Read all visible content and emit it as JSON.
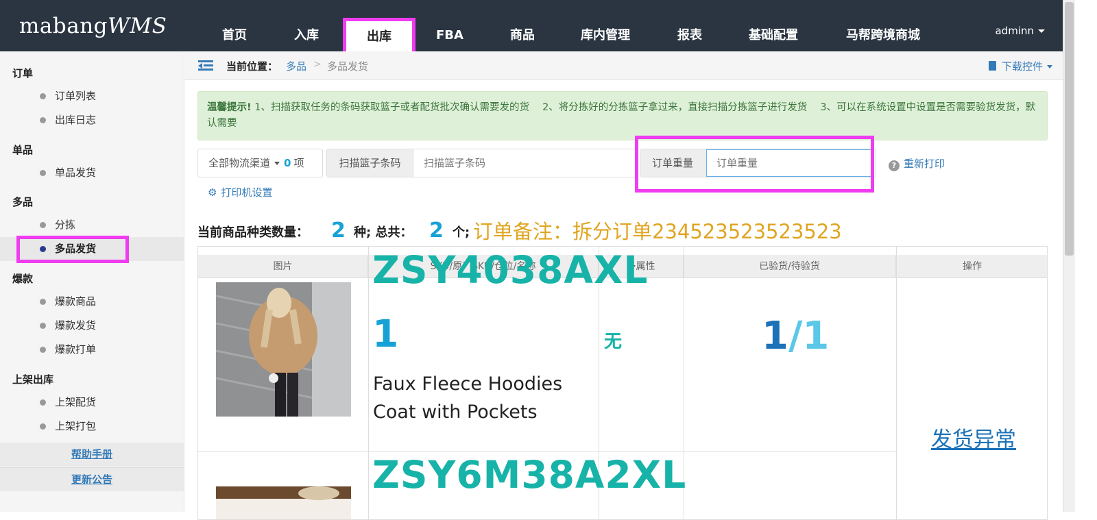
{
  "app": {
    "logo_main": "mabang",
    "logo_italic": "WMS",
    "user": "adminn"
  },
  "nav": [
    "首页",
    "入库",
    "出库",
    "FBA",
    "商品",
    "库内管理",
    "报表",
    "基础配置",
    "马帮跨境商城"
  ],
  "nav_active": "出库",
  "sidebar": {
    "groups": [
      {
        "title": "订单",
        "items": [
          "订单列表",
          "出库日志"
        ]
      },
      {
        "title": "单品",
        "items": [
          "单品发货"
        ]
      },
      {
        "title": "多品",
        "items": [
          "分拣",
          "多品发货"
        ]
      },
      {
        "title": "爆款",
        "items": [
          "爆款商品",
          "爆款发货",
          "爆款打单"
        ]
      },
      {
        "title": "上架出库",
        "items": [
          "上架配货",
          "上架打包"
        ]
      }
    ],
    "active_item": "多品发货",
    "links": [
      "帮助手册",
      "更新公告"
    ]
  },
  "breadcrumb": {
    "label": "当前位置：",
    "level1": "多品",
    "sep": ">",
    "level2": "多品发货"
  },
  "download_control": "下载控件",
  "alert": {
    "strong": "温馨提示!",
    "text": " 1、扫描获取任务的条码获取篮子或者配货批次确认需要发的货　 2、将分拣好的分拣篮子拿过来，直接扫描分拣篮子进行发货　 3、可以在系统设置中设置是否需要验货发货，默认需要"
  },
  "filters": {
    "channel_label": "全部物流渠道",
    "channel_count": "0",
    "channel_unit": "项",
    "basket_addon": "扫描篮子条码",
    "basket_placeholder": "扫描篮子条码",
    "weight_addon": "订单重量",
    "weight_placeholder": "订单重量",
    "reprint": "重新打印",
    "printer_settings": "打印机设置"
  },
  "summary": {
    "label_kinds": "当前商品种类数量：",
    "kinds": "2",
    "label_kind_unit": "种; 总共：",
    "total": "2",
    "label_total_unit": "个;",
    "note": "订单备注：拆分订单234523523523523"
  },
  "table": {
    "headers": [
      "图片",
      "SKU/原厂SKU/仓位/名称",
      "多属性",
      "已验货/待验货",
      "操作"
    ],
    "rows": [
      {
        "sku": "ZSY4038AXL",
        "qty": "1",
        "name": "Faux Fleece Hoodies Coat with Pockets",
        "attr": "无",
        "checked": "1",
        "pending": "/1"
      },
      {
        "sku": "ZSY6M38A2XL",
        "qty": "",
        "name": "",
        "attr": "",
        "checked": "",
        "pending": ""
      }
    ],
    "action": "发货异常"
  },
  "colors": {
    "nav_bg": "#2a3541",
    "highlight": "#f03cf0",
    "sku": "#17b3a8",
    "accent": "#17a2d6",
    "note": "#e0a521"
  }
}
